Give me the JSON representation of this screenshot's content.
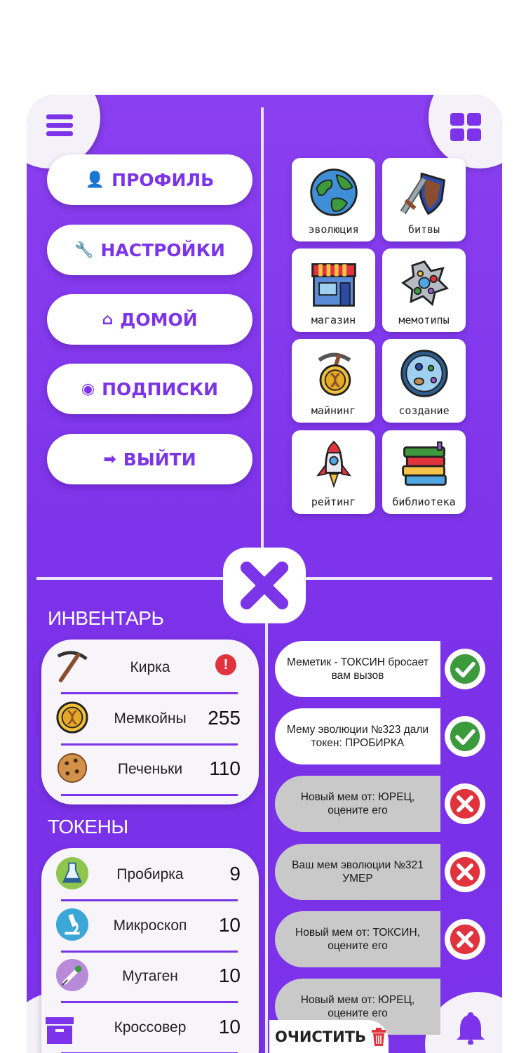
{
  "menu": {
    "items": [
      {
        "label": "ПРОФИЛЬ",
        "icon": "user-icon"
      },
      {
        "label": "НАСТРОЙКИ",
        "icon": "wrench-icon"
      },
      {
        "label": "ДОМОЙ",
        "icon": "home-icon"
      },
      {
        "label": "ПОДПИСКИ",
        "icon": "eye-icon"
      },
      {
        "label": "ВЫЙТИ",
        "icon": "logout-icon"
      }
    ]
  },
  "tiles": [
    {
      "label": "эволюция",
      "icon": "globe-icon"
    },
    {
      "label": "битвы",
      "icon": "sword-shield-icon"
    },
    {
      "label": "магазин",
      "icon": "shop-icon"
    },
    {
      "label": "мемотипы",
      "icon": "cell-icon"
    },
    {
      "label": "майнинг",
      "icon": "pickaxe-coin-icon"
    },
    {
      "label": "создание",
      "icon": "petri-dish-icon"
    },
    {
      "label": "рейтинг",
      "icon": "rocket-icon"
    },
    {
      "label": "библиотека",
      "icon": "books-icon"
    }
  ],
  "inventory": {
    "title": "ИНВЕНТАРЬ",
    "items": [
      {
        "name": "Кирка",
        "value": "!",
        "icon": "pickaxe-icon"
      },
      {
        "name": "Мемкойны",
        "value": "255",
        "icon": "coin-icon"
      },
      {
        "name": "Печеньки",
        "value": "110",
        "icon": "cookie-icon"
      }
    ]
  },
  "tokens": {
    "title": "ТОКЕНЫ",
    "items": [
      {
        "name": "Пробирка",
        "value": "9",
        "icon": "flask-icon"
      },
      {
        "name": "Микроскоп",
        "value": "10",
        "icon": "microscope-icon"
      },
      {
        "name": "Мутаген",
        "value": "10",
        "icon": "syringe-icon"
      },
      {
        "name": "Кроссовер",
        "value": "10",
        "icon": "crossover-icon"
      }
    ]
  },
  "notifications": [
    {
      "text": "Меметик - ТОКСИН бросает вам вызов",
      "status": "accept"
    },
    {
      "text": "Мему эволюции №323 дали токен: ПРОБИРКА",
      "status": "accept"
    },
    {
      "text": "Новый мем от: ЮРЕЦ, оцените его",
      "status": "reject"
    },
    {
      "text": "Ваш мем эволюции №321 УМЕР",
      "status": "reject"
    },
    {
      "text": "Новый мем от: ТОКСИН, оцените его",
      "status": "reject"
    },
    {
      "text": "Новый мем от: ЮРЕЦ, оцените его",
      "status": "reject"
    }
  ],
  "clear_label": "ОЧИСТИТЬ",
  "colors": {
    "accent": "#7b34e8",
    "accept": "#3a9a3c",
    "reject": "#e0333d"
  }
}
